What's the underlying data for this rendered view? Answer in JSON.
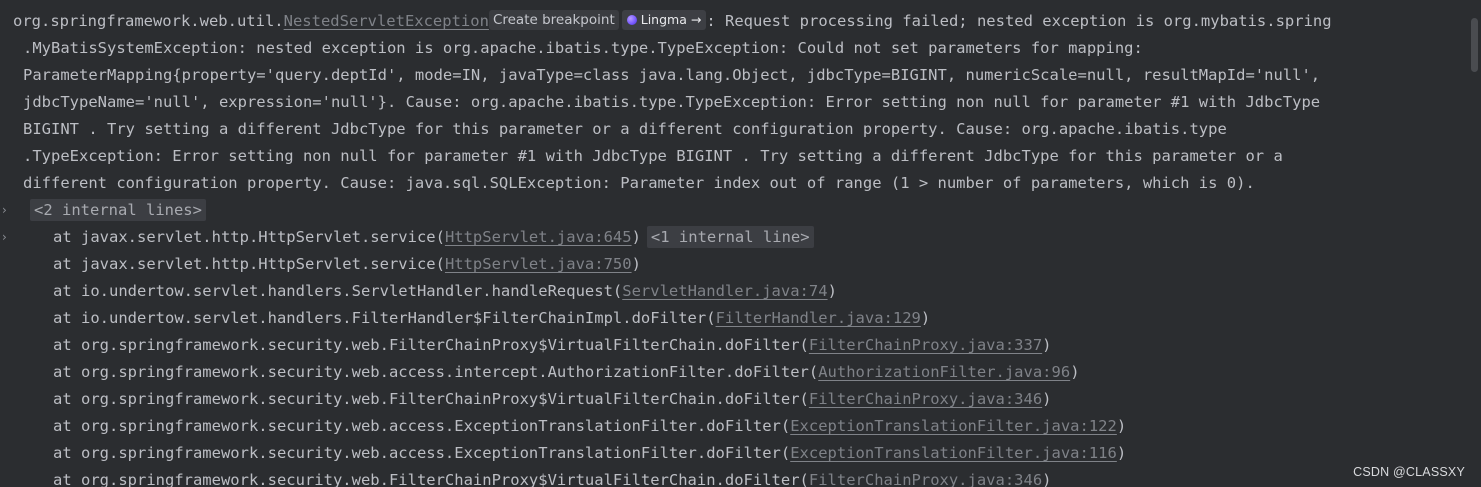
{
  "exception": {
    "line1_prefix": "org.springframework.web.util.",
    "exception_class": "NestedServletException",
    "create_breakpoint": "Create breakpoint",
    "lingma_label": "Lingma",
    "lingma_arrow": "→",
    "line1_suffix": ": Request processing failed; nested exception is org.mybatis.spring",
    "message_lines": [
      ".MyBatisSystemException: nested exception is org.apache.ibatis.type.TypeException: Could not set parameters for mapping:",
      "ParameterMapping{property='query.deptId', mode=IN, javaType=class java.lang.Object, jdbcType=BIGINT, numericScale=null, resultMapId='null',",
      "jdbcTypeName='null', expression='null'}. Cause: org.apache.ibatis.type.TypeException: Error setting non null for parameter #1 with JdbcType",
      "BIGINT . Try setting a different JdbcType for this parameter or a different configuration property. Cause: org.apache.ibatis.type",
      ".TypeException: Error setting non null for parameter #1 with JdbcType BIGINT . Try setting a different JdbcType for this parameter or a",
      "different configuration property. Cause: java.sql.SQLException: Parameter index out of range (1 > number of parameters, which is 0)."
    ]
  },
  "folds": {
    "arrow": "›",
    "internal_lines_2": "<2 internal lines>",
    "internal_line_1": "<1 internal line>"
  },
  "stack": [
    {
      "method": "at javax.servlet.http.HttpServlet.service(",
      "link": "HttpServlet.java:645",
      "close": ")"
    },
    {
      "method": "at javax.servlet.http.HttpServlet.service(",
      "link": "HttpServlet.java:750",
      "close": ")"
    },
    {
      "method": "at io.undertow.servlet.handlers.ServletHandler.handleRequest(",
      "link": "ServletHandler.java:74",
      "close": ")"
    },
    {
      "method": "at io.undertow.servlet.handlers.FilterHandler$FilterChainImpl.doFilter(",
      "link": "FilterHandler.java:129",
      "close": ")"
    },
    {
      "method": "at org.springframework.security.web.FilterChainProxy$VirtualFilterChain.doFilter(",
      "link": "FilterChainProxy.java:337",
      "close": ")"
    },
    {
      "method": "at org.springframework.security.web.access.intercept.AuthorizationFilter.doFilter(",
      "link": "AuthorizationFilter.java:96",
      "close": ")"
    },
    {
      "method": "at org.springframework.security.web.FilterChainProxy$VirtualFilterChain.doFilter(",
      "link": "FilterChainProxy.java:346",
      "close": ")"
    },
    {
      "method": "at org.springframework.security.web.access.ExceptionTranslationFilter.doFilter(",
      "link": "ExceptionTranslationFilter.java:122",
      "close": ")"
    },
    {
      "method": "at org.springframework.security.web.access.ExceptionTranslationFilter.doFilter(",
      "link": "ExceptionTranslationFilter.java:116",
      "close": ")"
    },
    {
      "method": "at org.springframework.security.web.FilterChainProxy$VirtualFilterChain.doFilter(",
      "link": "FilterChainProxy.java:346",
      "close": ")"
    }
  ],
  "watermark": "CSDN @CLASSXY",
  "colors": {
    "background": "#2b2d30",
    "text": "#bcbec4",
    "link": "#7f8288",
    "fold_background": "#3c3e43"
  }
}
